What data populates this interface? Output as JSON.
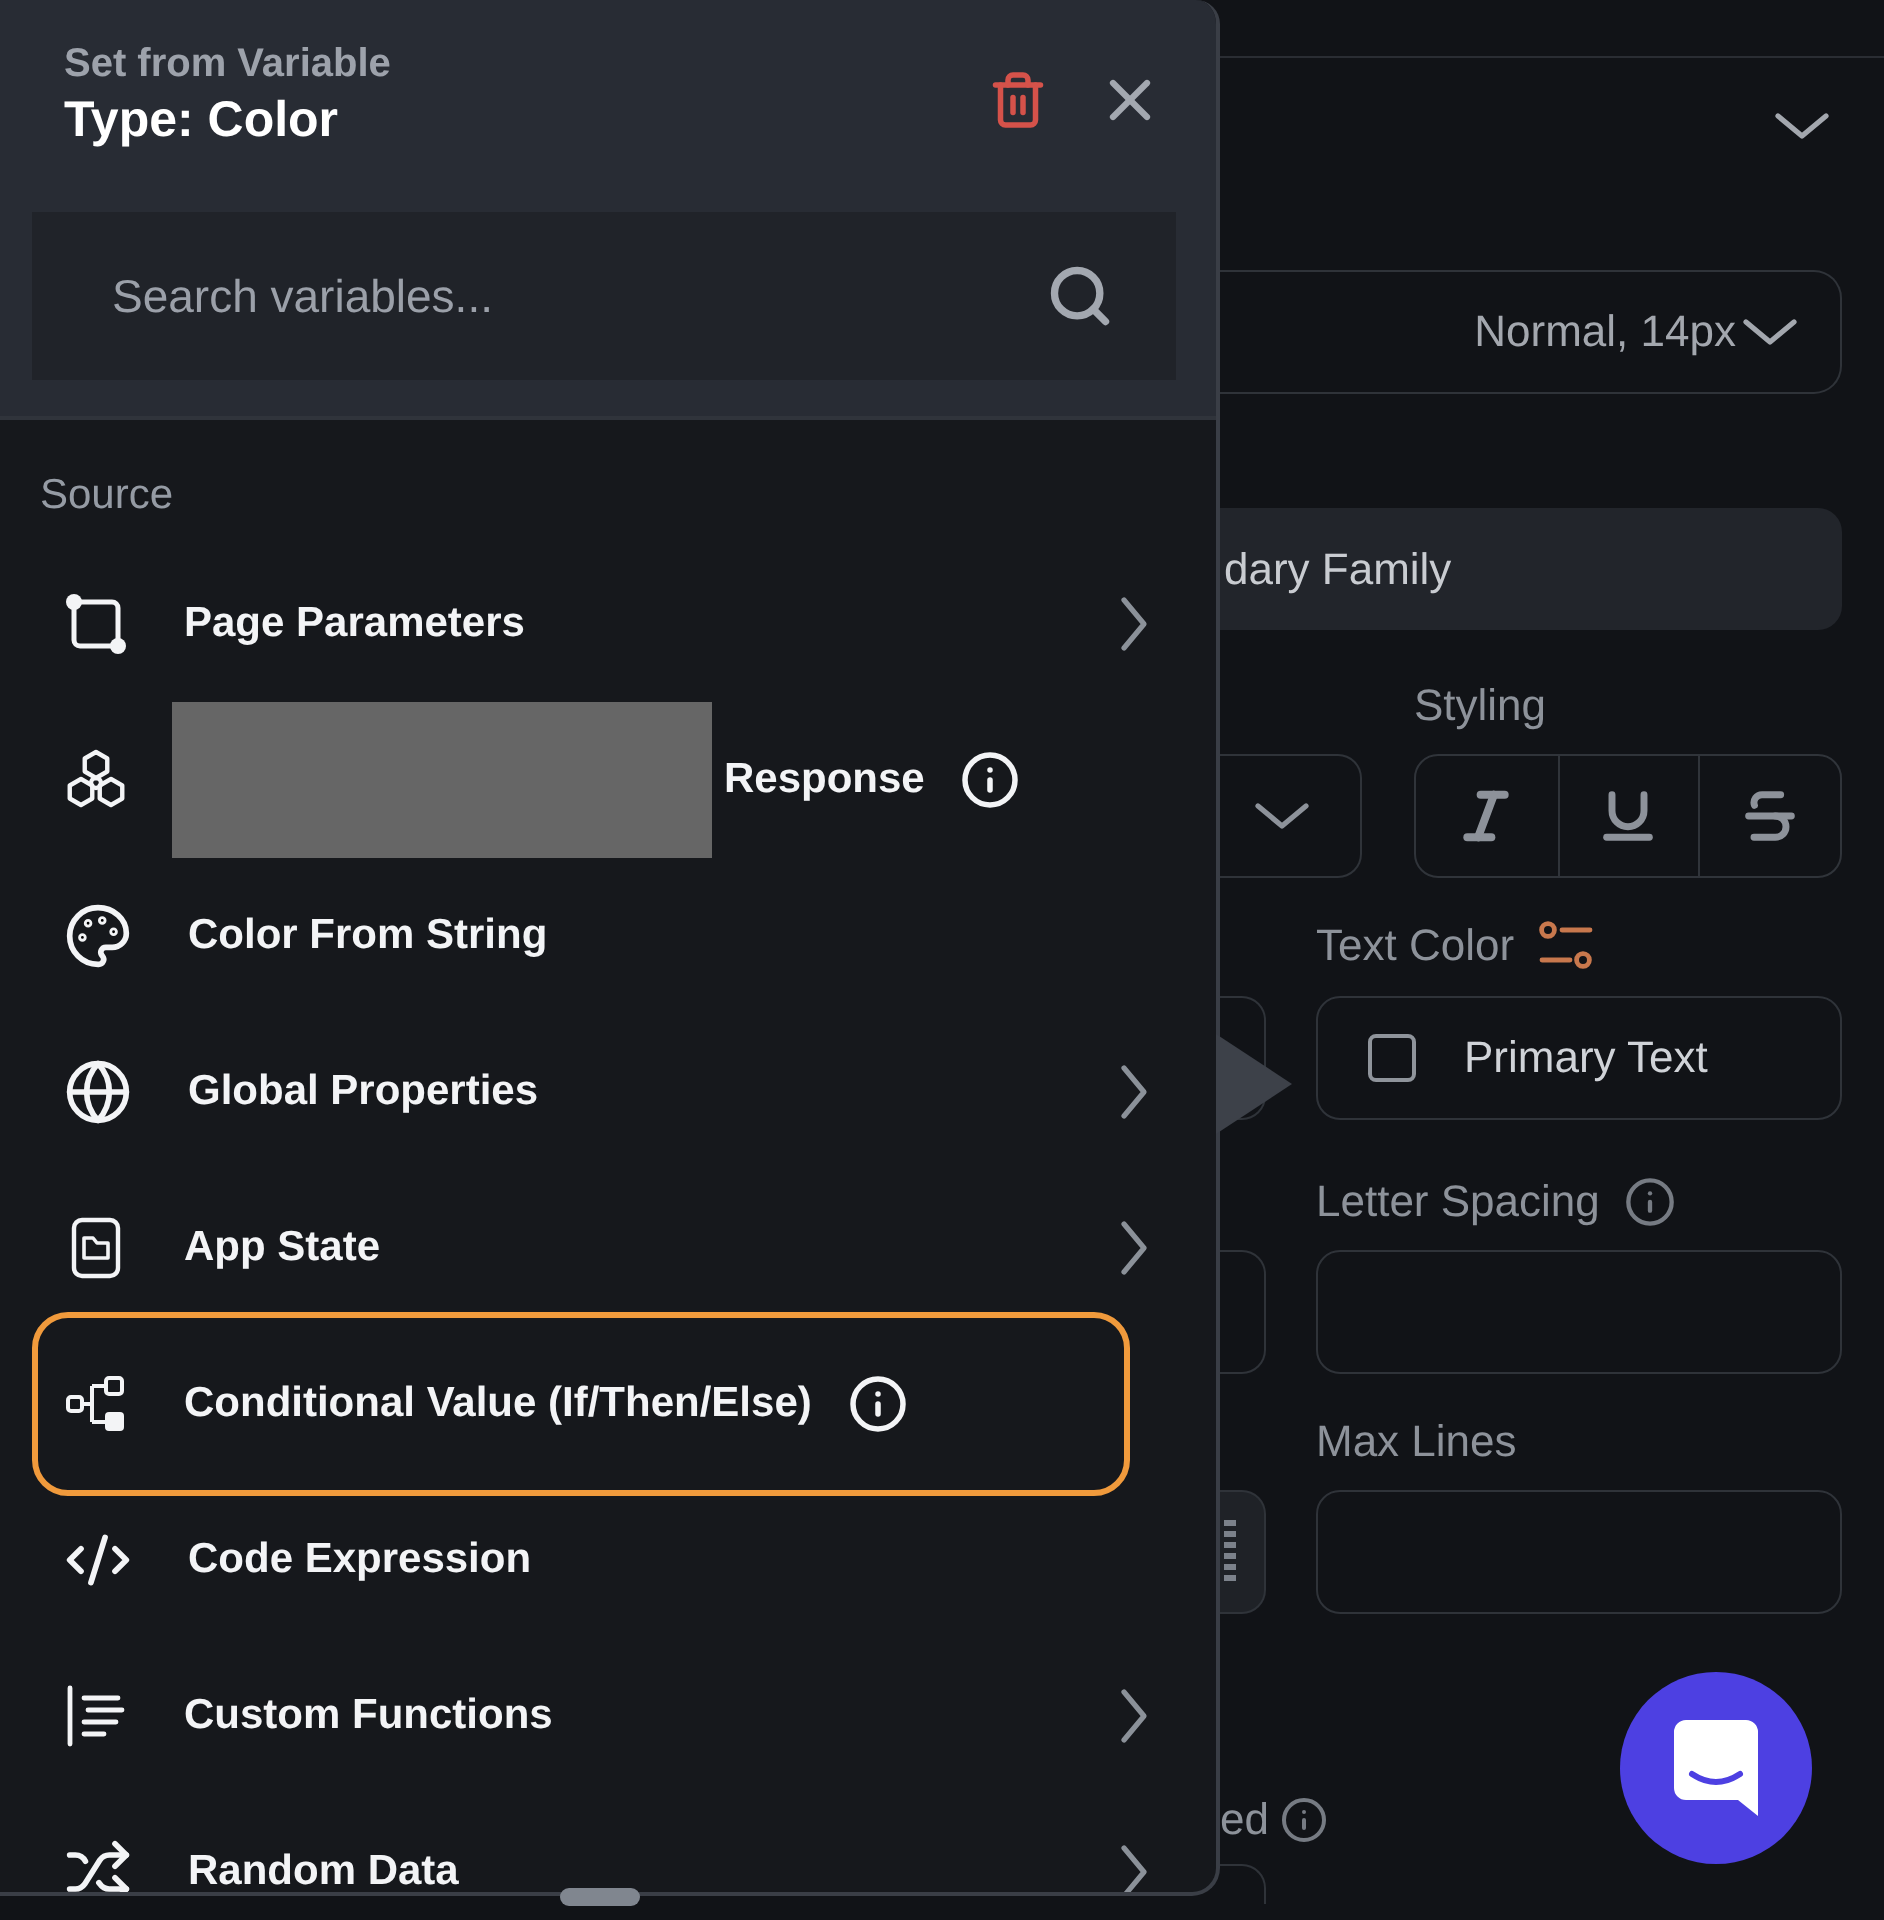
{
  "popup": {
    "subtitle": "Set from Variable",
    "title": "Type: Color",
    "search": {
      "placeholder": "Search variables..."
    },
    "section_label": "Source",
    "items": [
      {
        "label": "Page Parameters",
        "redacted": false,
        "info": false,
        "submenu": true,
        "highlighted": false
      },
      {
        "label": "Response",
        "redacted": true,
        "info": true,
        "submenu": false,
        "highlighted": false
      },
      {
        "label": "Color From String",
        "redacted": false,
        "info": false,
        "submenu": false,
        "highlighted": false
      },
      {
        "label": "Global Properties",
        "redacted": false,
        "info": false,
        "submenu": true,
        "highlighted": false
      },
      {
        "label": "App State",
        "redacted": false,
        "info": false,
        "submenu": true,
        "highlighted": false
      },
      {
        "label": "Conditional Value (If/Then/Else)",
        "redacted": false,
        "info": true,
        "submenu": false,
        "highlighted": true
      },
      {
        "label": "Code Expression",
        "redacted": false,
        "info": false,
        "submenu": false,
        "highlighted": false
      },
      {
        "label": "Custom Functions",
        "redacted": false,
        "info": false,
        "submenu": true,
        "highlighted": false
      },
      {
        "label": "Random Data",
        "redacted": false,
        "info": false,
        "submenu": true,
        "highlighted": false
      }
    ]
  },
  "panel": {
    "font_field": {
      "value": "Normal, 14px"
    },
    "family_field": {
      "value": "dary Family"
    },
    "styling": {
      "label": "Styling"
    },
    "text_color": {
      "label": "Text Color",
      "value": "Primary Text"
    },
    "letter_spacing": {
      "label": "Letter Spacing"
    },
    "max_lines": {
      "label": "Max Lines"
    },
    "cut_label": "ed"
  }
}
